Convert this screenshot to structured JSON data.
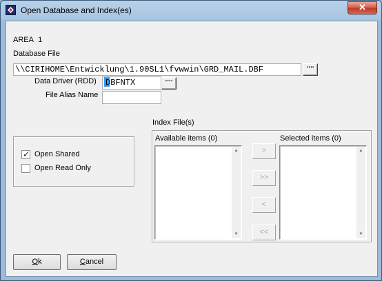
{
  "window": {
    "title": "Open Database and Index(es)",
    "close_glyph": "✕"
  },
  "area": {
    "label": "AREA",
    "value": "1"
  },
  "database_file": {
    "label": "Database File",
    "value": "\\\\CIRIHOME\\Entwicklung\\1.90SL1\\fvwwin\\GRD_MAIL.DBF",
    "browse_label": "...."
  },
  "data_driver": {
    "label": "Data Driver (RDD)",
    "value": "DBFNTX",
    "browse_label": "...."
  },
  "file_alias": {
    "label": "File Alias Name",
    "value": ""
  },
  "options": {
    "open_shared": {
      "label": "Open Shared",
      "checked": true,
      "mark": "✓"
    },
    "open_read_only": {
      "label": "Open Read Only",
      "checked": false
    }
  },
  "index_files": {
    "label": "Index File(s)",
    "available_label": "Available items (0)",
    "selected_label": "Selected items (0)",
    "move_buttons": [
      ">",
      ">>",
      "<",
      "<<"
    ],
    "scroll_up_glyph": "▲",
    "scroll_down_glyph": "▼"
  },
  "buttons": {
    "ok": {
      "mnemonic": "O",
      "rest": "k"
    },
    "cancel": {
      "mnemonic": "C",
      "rest": "ancel"
    }
  },
  "colors": {
    "accent": "#3399ff",
    "close_button": "#c0392b",
    "dialog_bg": "#f0f0f0"
  }
}
